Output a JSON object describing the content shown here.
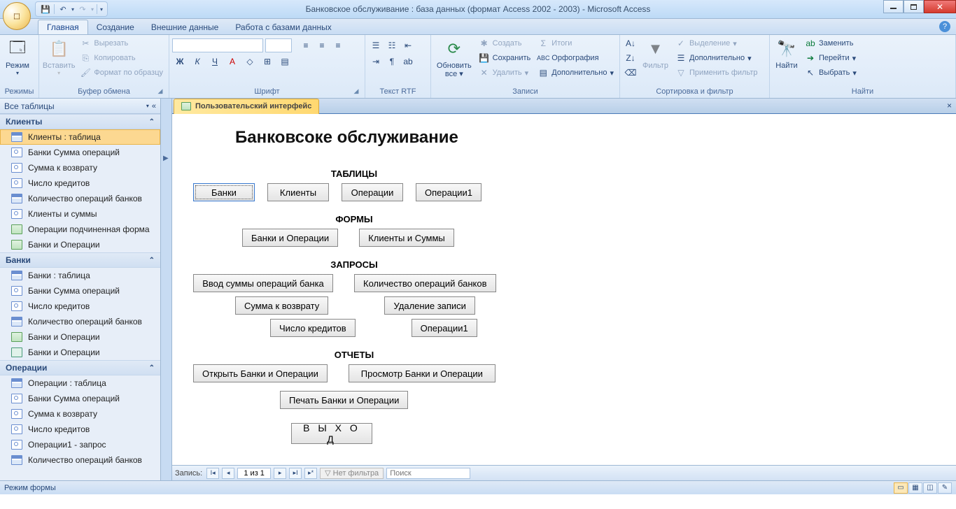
{
  "titlebar": {
    "title": "Банковское обслуживание : база данных (формат Access 2002 - 2003) - Microsoft Access"
  },
  "tabs": {
    "home": "Главная",
    "create": "Создание",
    "external": "Внешние данные",
    "dbtools": "Работа с базами данных"
  },
  "ribbon": {
    "modes_group": "Режимы",
    "mode_btn": "Режим",
    "clipboard_group": "Буфер обмена",
    "paste": "Вставить",
    "cut": "Вырезать",
    "copy": "Копировать",
    "format_painter": "Формат по образцу",
    "font_group": "Шрифт",
    "richtext_group": "Текст RTF",
    "records_group": "Записи",
    "refresh": "Обновить",
    "refresh_all": "все",
    "rec_new": "Создать",
    "rec_save": "Сохранить",
    "rec_delete": "Удалить",
    "rec_totals": "Итоги",
    "rec_spell": "Орфография",
    "rec_more": "Дополнительно",
    "sortfilter_group": "Сортировка и фильтр",
    "filter": "Фильтр",
    "sel": "Выделение",
    "adv": "Дополнительно",
    "apply": "Применить фильтр",
    "find_group": "Найти",
    "find": "Найти",
    "replace": "Заменить",
    "goto": "Перейти",
    "select": "Выбрать"
  },
  "nav": {
    "header": "Все таблицы",
    "groups": [
      {
        "name": "Клиенты",
        "items": [
          {
            "t": "table",
            "n": "Клиенты : таблица",
            "sel": true
          },
          {
            "t": "query",
            "n": "Банки Сумма операций"
          },
          {
            "t": "query",
            "n": "Сумма к возврату"
          },
          {
            "t": "query",
            "n": "Число кредитов"
          },
          {
            "t": "table",
            "n": "Количество операций банков"
          },
          {
            "t": "query",
            "n": "Клиенты и суммы"
          },
          {
            "t": "form",
            "n": "Операции подчиненная форма"
          },
          {
            "t": "form",
            "n": "Банки и Операции"
          }
        ]
      },
      {
        "name": "Банки",
        "items": [
          {
            "t": "table",
            "n": "Банки : таблица"
          },
          {
            "t": "query",
            "n": "Банки Сумма операций"
          },
          {
            "t": "query",
            "n": "Число кредитов"
          },
          {
            "t": "table",
            "n": "Количество операций банков"
          },
          {
            "t": "form",
            "n": "Банки и Операции"
          },
          {
            "t": "report",
            "n": "Банки и Операции"
          }
        ]
      },
      {
        "name": "Операции",
        "items": [
          {
            "t": "table",
            "n": "Операции : таблица"
          },
          {
            "t": "query",
            "n": "Банки Сумма операций"
          },
          {
            "t": "query",
            "n": "Сумма к возврату"
          },
          {
            "t": "query",
            "n": "Число кредитов"
          },
          {
            "t": "query",
            "n": "Операции1 - запрос"
          },
          {
            "t": "table",
            "n": "Количество операций банков"
          }
        ]
      }
    ]
  },
  "doc": {
    "tab_label": "Пользовательский интерфейс",
    "form_title": "Банковсоке обслуживание",
    "sec_tables": "ТАБЛИЦЫ",
    "btn_banks": "Банки",
    "btn_clients": "Клиенты",
    "btn_ops": "Операции",
    "btn_ops1": "Операции1",
    "sec_forms": "ФОРМЫ",
    "btn_banks_ops": "Банки и Операции",
    "btn_clients_sums": "Клиенты и Суммы",
    "sec_queries": "ЗАПРОСЫ",
    "btn_q1": "Ввод суммы операций банка",
    "btn_q2": "Количество операций банков",
    "btn_q3": "Сумма к возврату",
    "btn_q4": "Удаление записи",
    "btn_q5": "Число кредитов",
    "btn_q6": "Операции1",
    "sec_reports": "ОТЧЕТЫ",
    "btn_r1": "Открыть Банки и Операции",
    "btn_r2": "Просмотр Банки и Операции",
    "btn_r3": "Печать Банки и Операции",
    "btn_exit": "В Ы Х О Д"
  },
  "recordbar": {
    "label": "Запись:",
    "pos": "1 из 1",
    "nofilter": "Нет фильтра",
    "search": "Поиск"
  },
  "statusbar": {
    "mode": "Режим формы"
  }
}
